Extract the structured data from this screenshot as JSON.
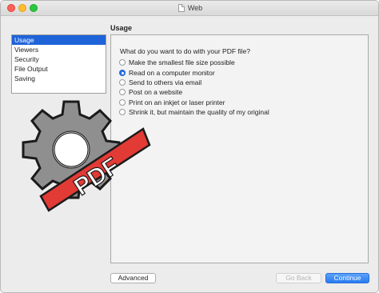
{
  "window": {
    "title": "Web"
  },
  "sidebar": {
    "items": [
      {
        "label": "Usage",
        "selected": true
      },
      {
        "label": "Viewers",
        "selected": false
      },
      {
        "label": "Security",
        "selected": false
      },
      {
        "label": "File Output",
        "selected": false
      },
      {
        "label": "Saving",
        "selected": false
      }
    ]
  },
  "main": {
    "section_title": "Usage",
    "question": "What do you want to do with your PDF file?",
    "options": [
      {
        "label": "Make the smallest file size possible",
        "checked": false
      },
      {
        "label": "Read on a computer monitor",
        "checked": true
      },
      {
        "label": "Send to others via email",
        "checked": false
      },
      {
        "label": "Post on a website",
        "checked": false
      },
      {
        "label": "Print on an inkjet or laser printer",
        "checked": false
      },
      {
        "label": "Shrink it, but maintain the quality of my original",
        "checked": false
      }
    ]
  },
  "logo": {
    "icon": "gear-pdf-logo-icon",
    "text": "PDF",
    "colors": {
      "gear": "#8f8f8f",
      "ribbon": "#e23a35"
    }
  },
  "buttons": {
    "advanced": "Advanced",
    "back": "Go Back",
    "continue": "Continue"
  },
  "colors": {
    "accent": "#2a73e8",
    "selection": "#1f63d8"
  }
}
